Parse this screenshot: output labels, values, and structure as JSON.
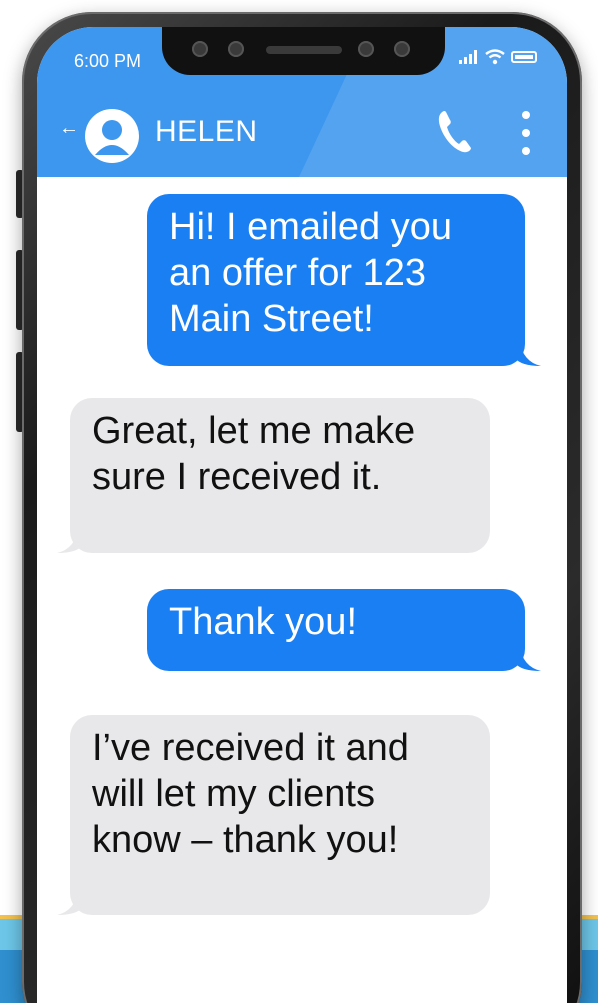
{
  "status_bar": {
    "time": "6:00 PM"
  },
  "header": {
    "back_label": "←",
    "contact_name": "HELEN"
  },
  "messages": [
    {
      "direction": "sent",
      "text": "Hi! I emailed you an offer for 123 Main Street!"
    },
    {
      "direction": "received",
      "text": "Great, let me make sure I received it."
    },
    {
      "direction": "sent",
      "text": "Thank you!"
    },
    {
      "direction": "received",
      "text": "I’ve received it and will let my clients know – thank you!"
    }
  ],
  "colors": {
    "header": "#3d97ee",
    "sent_bubble": "#1a7ff2",
    "received_bubble": "#e8e8ea"
  },
  "icons": {
    "back": "back-arrow-icon",
    "avatar": "person-icon",
    "call": "phone-icon",
    "menu": "more-vertical-icon",
    "signal": "signal-icon",
    "wifi": "wifi-icon",
    "battery": "battery-icon"
  }
}
